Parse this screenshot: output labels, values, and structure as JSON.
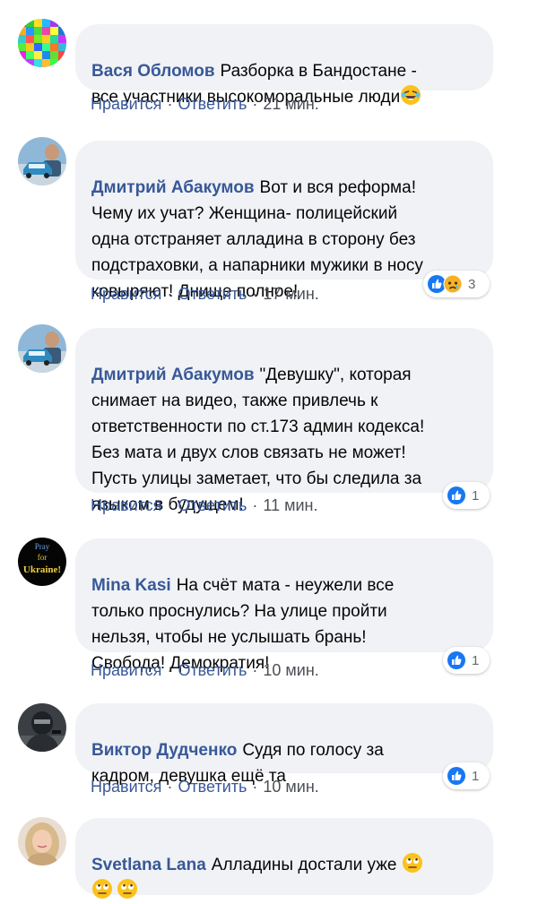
{
  "actions": {
    "like": "Нравится",
    "reply": "Ответить",
    "separator": "·"
  },
  "comments": [
    {
      "author": "Вася Обломов",
      "text": "Разборка в Бандостане -\nвсе участники высокоморальные люди",
      "time": "21 мин.",
      "avatar_icon": "colorful-grid-avatar",
      "emoji": [
        "crying-laughing-emoji"
      ]
    },
    {
      "author": "Дмитрий Абакумов",
      "text": "Вот и вся реформа!\nЧему их учат? Женщина- полицейский\nодна отстраняет алладина в сторону без\nподстраховки, а напарники мужики в носу\nковыряют! Днище полное!",
      "time": "17 мин.",
      "avatar_icon": "man-with-car-avatar",
      "reactions": {
        "types": [
          "like",
          "sad"
        ],
        "count": "3"
      }
    },
    {
      "author": "Дмитрий Абакумов",
      "text": "\"Девушку\", которая\nснимает на видео, также привлечь к\nответственности по ст.173 админ кодекса!\nБез мата и двух слов связать не может!\nПусть улицы заметает, что бы следила за\nязыком в будущем!",
      "time": "11 мин.",
      "avatar_icon": "man-with-car-avatar",
      "reactions": {
        "types": [
          "like"
        ],
        "count": "1"
      }
    },
    {
      "author": "Mina Kasi",
      "text": "На счёт мата - неужели все\nтолько проснулись? На улице пройти\nнельзя, чтобы не услышать брань!\nСвобода! Демократия!",
      "time": "10 мин.",
      "avatar_icon": "pray-for-ukraine-avatar",
      "avatar_text": [
        "Pray",
        "for",
        "Ukraine!"
      ],
      "reactions": {
        "types": [
          "like"
        ],
        "count": "1"
      }
    },
    {
      "author": "Виктор Дудченко",
      "text": "Судя по голосу за\nкадром, девушка ещё та",
      "time": "10 мин.",
      "avatar_icon": "soldier-avatar",
      "reactions": {
        "types": [
          "like"
        ],
        "count": "1"
      }
    },
    {
      "author": "Svetlana Lana",
      "text": "Алладины достали уже",
      "time": "",
      "avatar_icon": "woman-portrait-avatar",
      "emoji": [
        "rolling-eyes-emoji",
        "rolling-eyes-emoji",
        "rolling-eyes-emoji"
      ]
    }
  ],
  "colors": {
    "author": "#385898",
    "bubble": "#f0f2f5",
    "like": "#1877f2",
    "sad": "#f7b125"
  }
}
